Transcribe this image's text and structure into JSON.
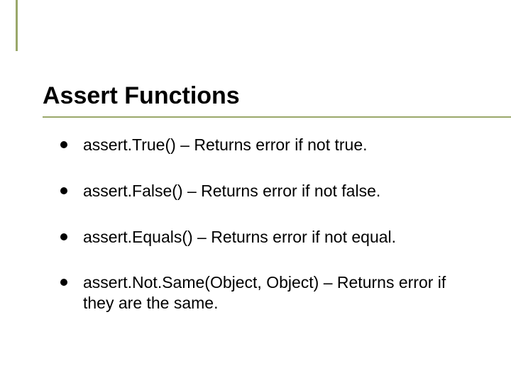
{
  "slide": {
    "title": "Assert Functions",
    "accent_color": "#9aa86a",
    "bullets": [
      "assert.True() – Returns error if not true.",
      "assert.False() – Returns error if not false.",
      "assert.Equals() – Returns error if not equal.",
      "assert.Not.Same(Object, Object) – Returns error if they are the same."
    ]
  }
}
